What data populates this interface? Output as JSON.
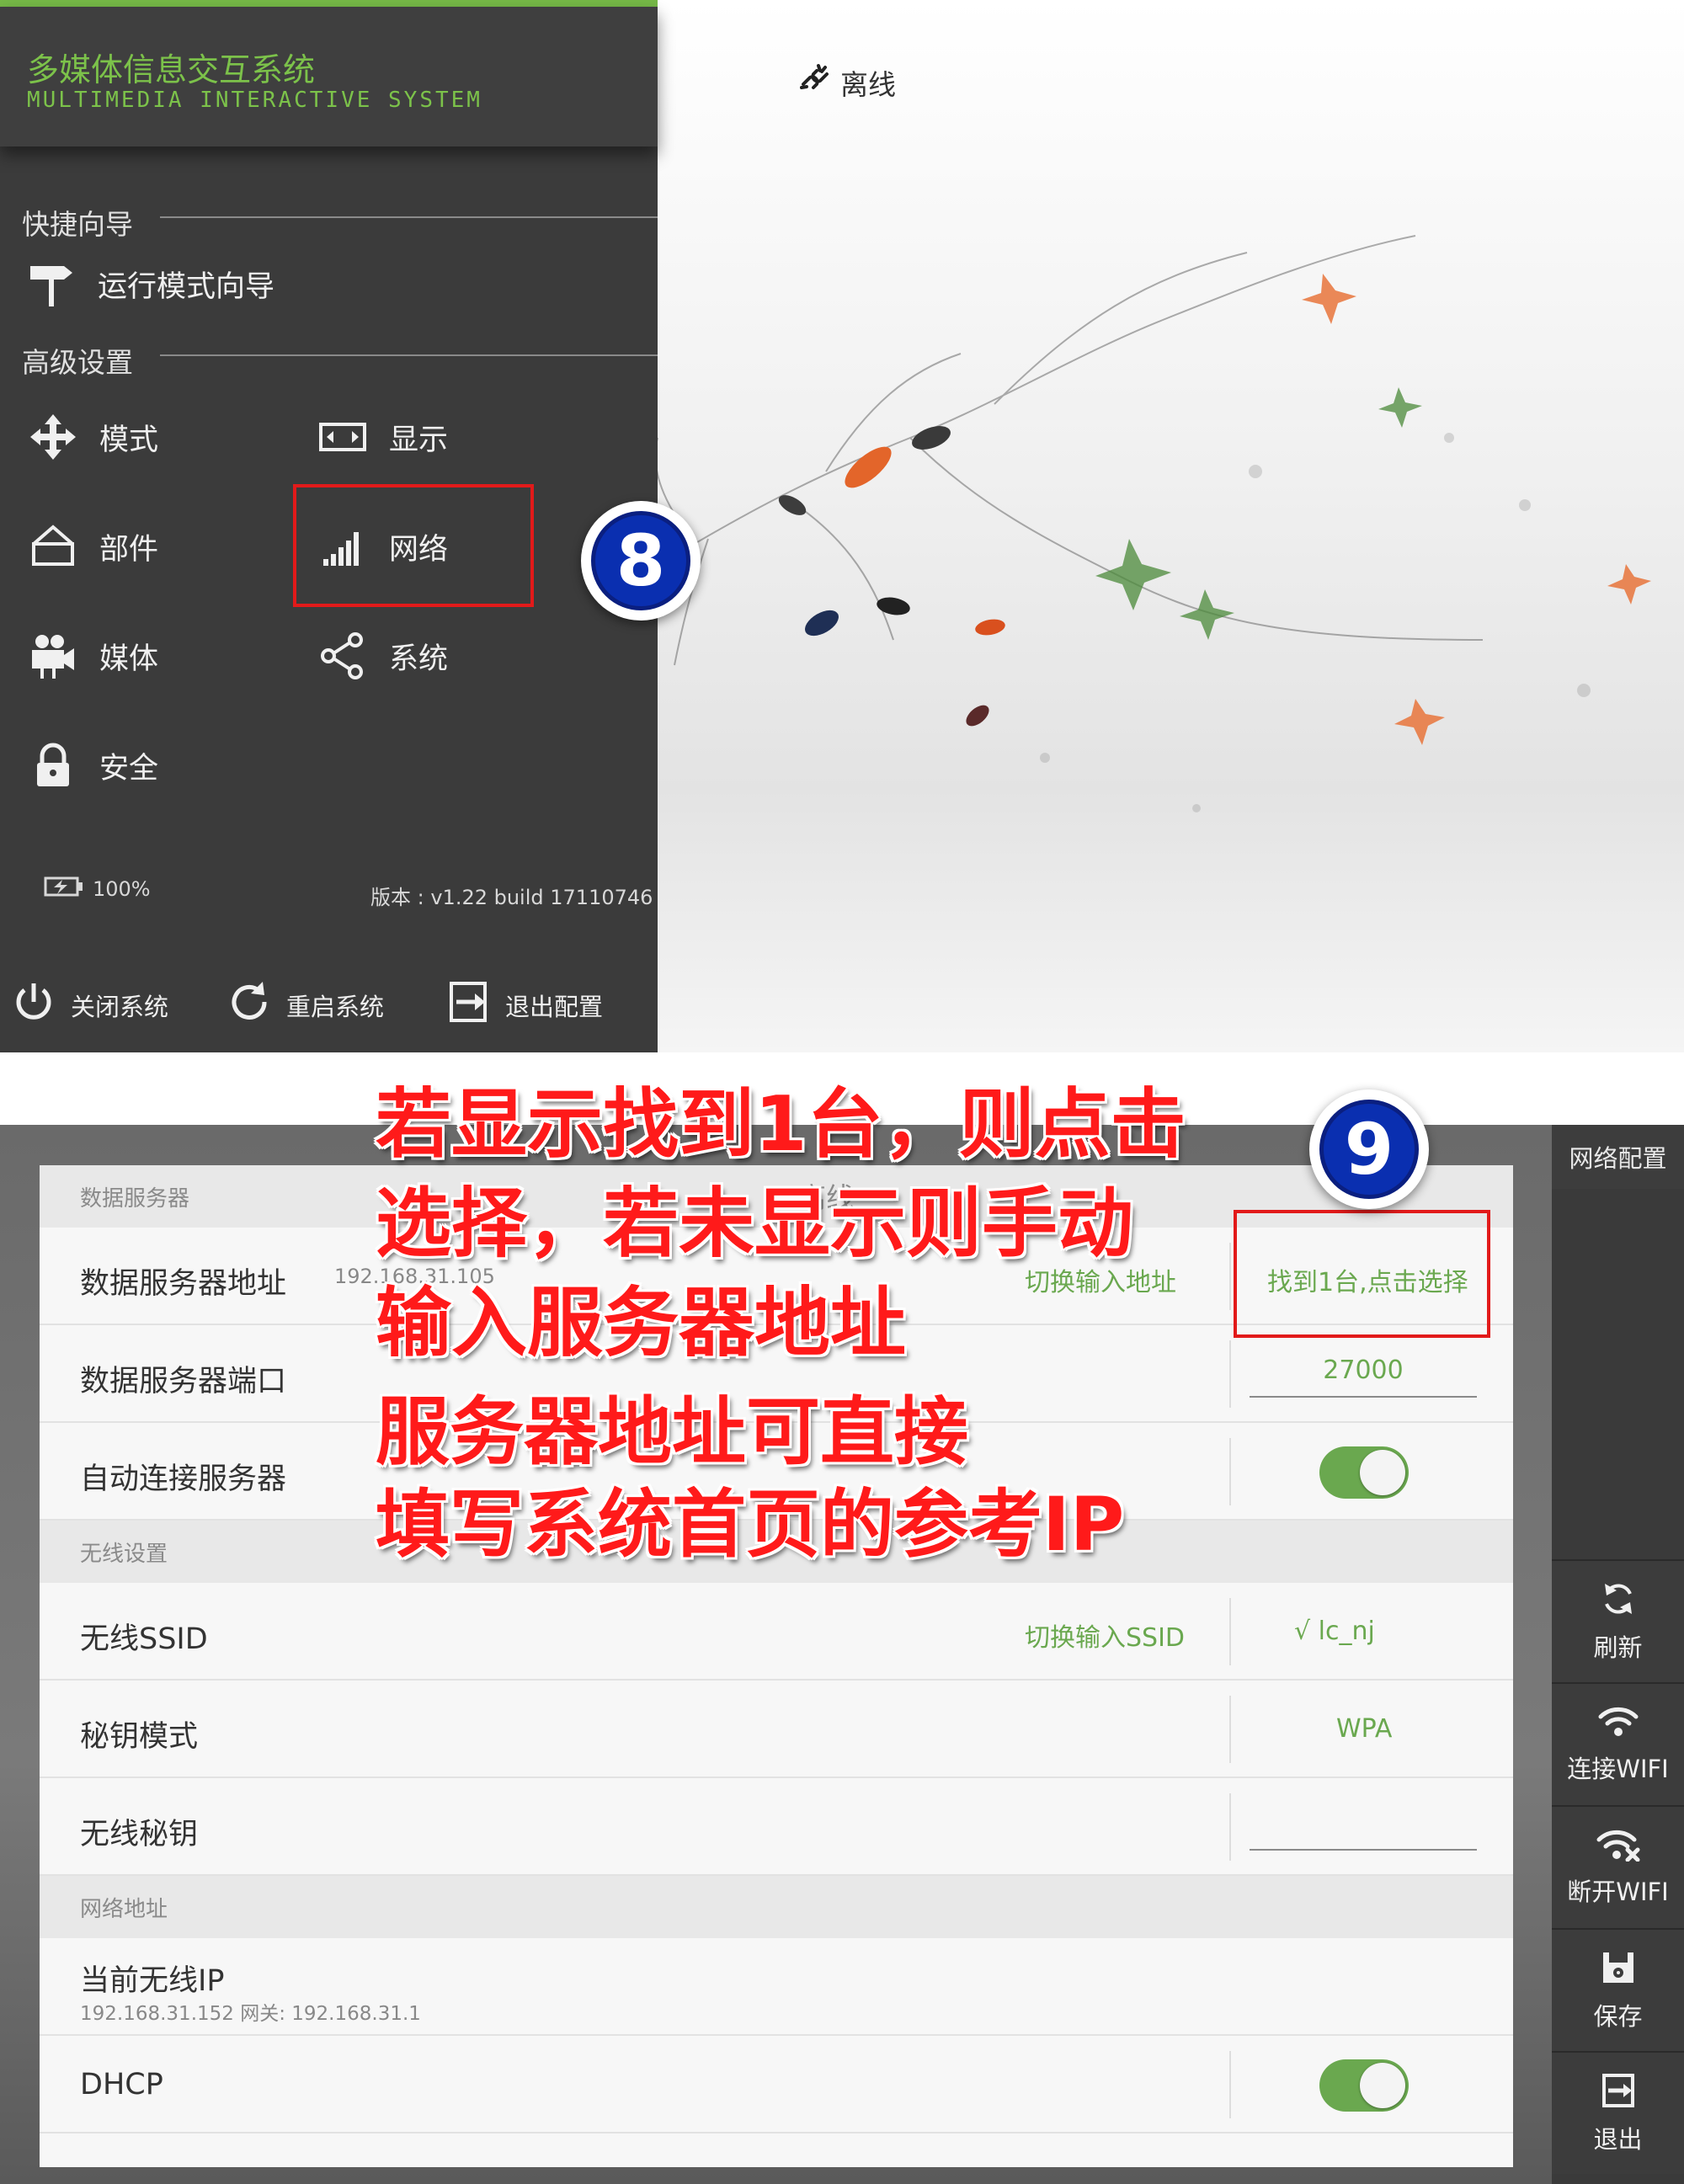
{
  "top": {
    "app_title": "多媒体信息交互系统",
    "app_subtitle": "MULTIMEDIA INTERACTIVE SYSTEM",
    "status_offline": "离线",
    "section_quick": "快捷向导",
    "quick_item": "运行模式向导",
    "section_advanced": "高级设置",
    "menu": {
      "mode": "模式",
      "display": "显示",
      "parts": "部件",
      "network": "网络",
      "media": "媒体",
      "system": "系统",
      "security": "安全"
    },
    "battery": "100%",
    "version": "版本 : v1.22 build 17110746",
    "bottom": {
      "shutdown": "关闭系统",
      "restart": "重启系统",
      "exit_config": "退出配置"
    },
    "badge_step": "8"
  },
  "bottom": {
    "groups": {
      "data_server": "数据服务器",
      "wireless": "无线设置",
      "network_addr": "网络地址"
    },
    "rows": {
      "server_addr_label": "数据服务器地址",
      "server_addr_value": "192.168.31.105",
      "switch_input_addr": "切换输入地址",
      "found_select": "找到1台,点击选择",
      "server_port_label": "数据服务器端口",
      "server_port_value": "27000",
      "auto_connect_label": "自动连接服务器",
      "ssid_label": "无线SSID",
      "switch_input_ssid": "切换输入SSID",
      "ssid_value": "√ lc_nj",
      "key_mode_label": "秘钥模式",
      "key_mode_value": "WPA",
      "wifi_key_label": "无线秘钥",
      "current_ip_label": "当前无线IP",
      "current_ip_sub": "192.168.31.152 网关: 192.168.31.1",
      "dhcp_label": "DHCP"
    },
    "toggles": {
      "auto_connect": true,
      "dhcp": true
    },
    "right_panel": {
      "title": "网络配置",
      "refresh": "刷新",
      "connect_wifi": "连接WIFI",
      "disconnect_wifi": "断开WIFI",
      "save": "保存",
      "exit": "退出"
    },
    "badge_step": "9"
  },
  "annotation": {
    "line1": "若显示找到1台，则点击",
    "line2": "选择，若未显示则手动",
    "line3": "输入服务器地址",
    "line4": "服务器地址可直接",
    "line5": "填写系统首页的参考IP"
  },
  "colors": {
    "accent_green": "#76b947",
    "sidebar_bg": "#3b3b3b",
    "highlight_red": "#e21a1a",
    "badge_blue": "#0a2fb0"
  }
}
